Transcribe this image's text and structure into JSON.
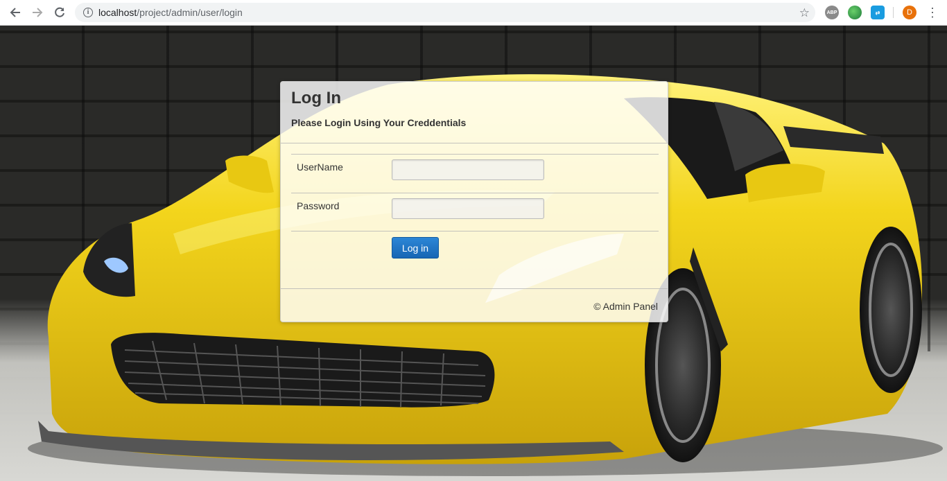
{
  "browser": {
    "url_host": "localhost",
    "url_path": "/project/admin/user/login",
    "profile_initial": "D",
    "extensions": [
      "ABP",
      "globe-extension",
      "translate-extension"
    ]
  },
  "login": {
    "title": "Log In",
    "subtitle": "Please Login Using Your Creddentials",
    "username_label": "UserName",
    "username_value": "",
    "password_label": "Password",
    "password_value": "",
    "submit_label": "Log in",
    "footer": "© Admin Panel"
  },
  "colors": {
    "button": "#1e73be",
    "car": "#f2d21a"
  }
}
